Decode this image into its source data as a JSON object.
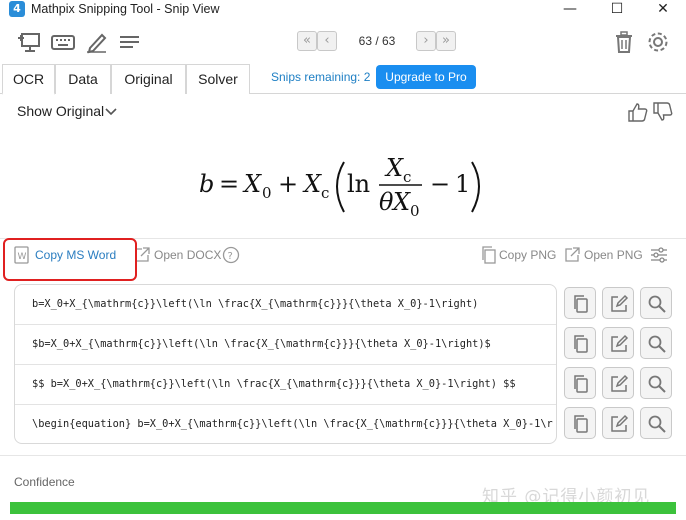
{
  "window": {
    "title": "Mathpix Snipping Tool - Snip View",
    "logo_text": "4",
    "minimize": "—",
    "maximize": "☐",
    "close": "✕"
  },
  "toolbar": {
    "nav_first": "«",
    "nav_prev": "‹",
    "counter": "63 / 63",
    "nav_next": "›",
    "nav_last": "»"
  },
  "tabs": [
    {
      "label": "OCR",
      "active": true
    },
    {
      "label": "Data",
      "active": false
    },
    {
      "label": "Original",
      "active": false
    },
    {
      "label": "Solver",
      "active": false
    }
  ],
  "snips_remaining": "Snips remaining: 2",
  "upgrade_label": "Upgrade to Pro",
  "show_original_label": "Show Original",
  "math_render": {
    "b": "b",
    "eq": "=",
    "X": "X",
    "sub0": "0",
    "plus": "+",
    "subc": "c",
    "ln": "ln",
    "theta": "θ",
    "minus": "−",
    "one": "1"
  },
  "actions": {
    "copy_ms_word": "Copy MS Word",
    "open_docx": "Open DOCX",
    "copy_png": "Copy PNG",
    "open_png": "Open PNG"
  },
  "latex_rows": [
    "b=X_0+X_{\\mathrm{c}}\\left(\\ln \\frac{X_{\\mathrm{c}}}{\\theta X_0}-1\\right)",
    "$b=X_0+X_{\\mathrm{c}}\\left(\\ln \\frac{X_{\\mathrm{c}}}{\\theta X_0}-1\\right)$",
    "$$  b=X_0+X_{\\mathrm{c}}\\left(\\ln \\frac{X_{\\mathrm{c}}}{\\theta X_0}-1\\right)  $$",
    "\\begin{equation}  b=X_0+X_{\\mathrm{c}}\\left(\\ln \\frac{X_{\\mathrm{c}}}{\\theta X_0}-1\\r"
  ],
  "confidence_label": "Confidence",
  "confidence_value": 1.0,
  "watermark": "知乎 @记得小颜初见",
  "colors": {
    "accent": "#1a8ef0",
    "link": "#2a7dc0",
    "highlight_box": "#e02020",
    "confidence_bar": "#3cc23c"
  }
}
